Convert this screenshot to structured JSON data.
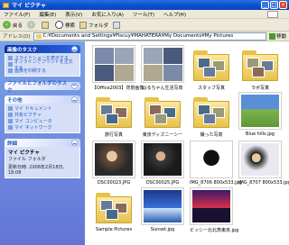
{
  "window": {
    "title": "マイ ピクチャ"
  },
  "menu": [
    "ファイル(F)",
    "編集(E)",
    "表示(V)",
    "お気に入り(A)",
    "ツール(T)",
    "ヘルプ(H)"
  ],
  "toolbar": {
    "back": "戻る",
    "search": "検索",
    "folders": "フォルダ"
  },
  "address": {
    "label": "アドレス(D)",
    "path": "C:¥Documents and Settings¥Fiscuy¥MAHATERA¥My Documents¥My Pictures",
    "go": "移動"
  },
  "sidebar": {
    "picture_tasks": {
      "title": "画像のタスク",
      "items": [
        "スライドショーを表示する",
        "オンラインでプリントを注文する",
        "画像を印刷する"
      ]
    },
    "file_tasks": {
      "title": "ファイルとフォルダのタスク"
    },
    "other_places": {
      "title": "その他",
      "items": [
        "マイ ドキュメント",
        "共有ピクチャ",
        "マイ コンピュータ",
        "マイ ネットワーク"
      ]
    },
    "details": {
      "title": "詳細",
      "name": "マイ ピクチャ",
      "type": "ファイル フォルダ",
      "modified": "更新日時: 2008年2月18日、18:08"
    }
  },
  "files": [
    {
      "name": "【Office2003】背景画像",
      "kind": "quad"
    },
    {
      "name": "はるちゃん生活写真",
      "kind": "quad"
    },
    {
      "name": "スタッフ写真",
      "kind": "folder"
    },
    {
      "name": "ラボ写真",
      "kind": "folder"
    },
    {
      "name": "旅行写真",
      "kind": "folder"
    },
    {
      "name": "東京ディズニーシー",
      "kind": "folder"
    },
    {
      "name": "撮った写真",
      "kind": "folder"
    },
    {
      "name": "Blue hills.jpg",
      "kind": "image"
    },
    {
      "name": "DSC00023.JPG",
      "kind": "image"
    },
    {
      "name": "DSC00025.JPG",
      "kind": "image"
    },
    {
      "name": "IMG_8706 800x533.jpg",
      "kind": "image"
    },
    {
      "name": "IMG_8707 800x533.jpg",
      "kind": "image"
    },
    {
      "name": "Sample Pictures",
      "kind": "folder"
    },
    {
      "name": "Sunset.jpg",
      "kind": "image"
    },
    {
      "name": "ビッシー北北斎東京.jpg",
      "kind": "image"
    }
  ]
}
